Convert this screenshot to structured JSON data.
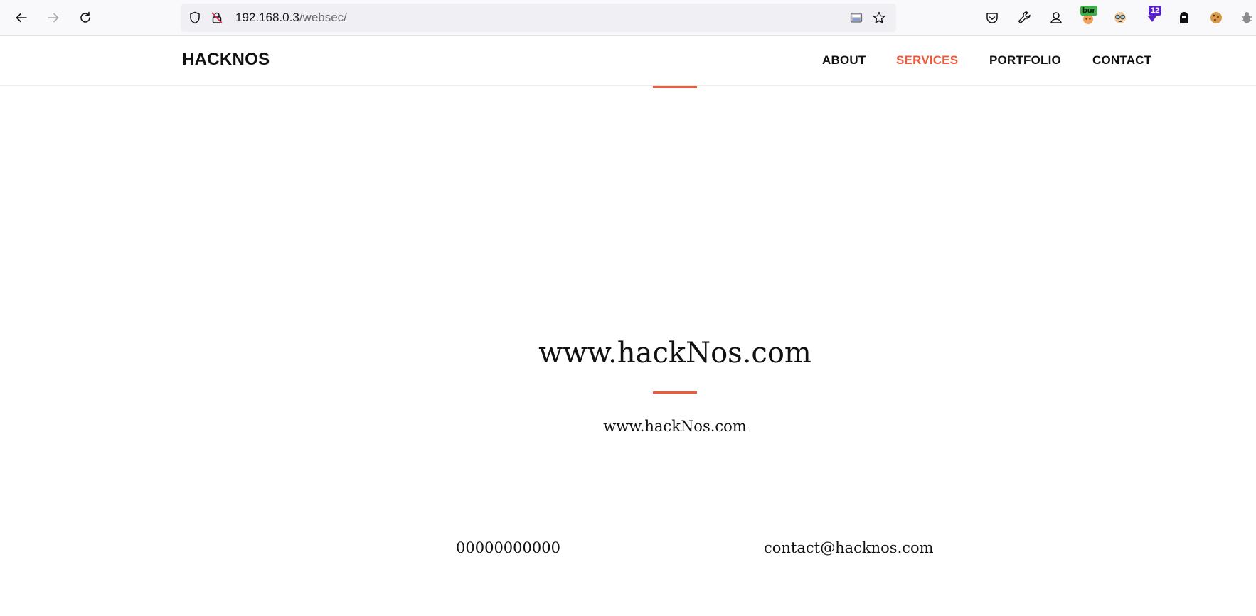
{
  "browser": {
    "url_host": "192.168.0.3",
    "url_path": "/websec/",
    "icons": {
      "back": "back-arrow-icon",
      "forward": "forward-arrow-icon",
      "reload": "reload-icon",
      "shield": "tracking-protection-shield-icon",
      "insecure": "insecure-lock-icon",
      "reader": "reader-view-icon",
      "bookmark": "bookmark-star-icon"
    },
    "extensions": {
      "pocket": "pocket-icon",
      "tools": "wrench-icon",
      "account": "account-icon",
      "burp_badge": "bur",
      "counter_badge": "12"
    }
  },
  "site": {
    "brand": "HACKNOS",
    "nav": [
      {
        "label": "ABOUT",
        "active": false
      },
      {
        "label": "SERVICES",
        "active": true
      },
      {
        "label": "PORTFOLIO",
        "active": false
      },
      {
        "label": "CONTACT",
        "active": false
      }
    ],
    "accent_color": "#ef5a3a"
  },
  "main": {
    "title": "www.hackNos.com",
    "subtitle": "www.hackNos.com"
  },
  "contact": {
    "phone": "00000000000",
    "email": "contact@hacknos.com"
  }
}
